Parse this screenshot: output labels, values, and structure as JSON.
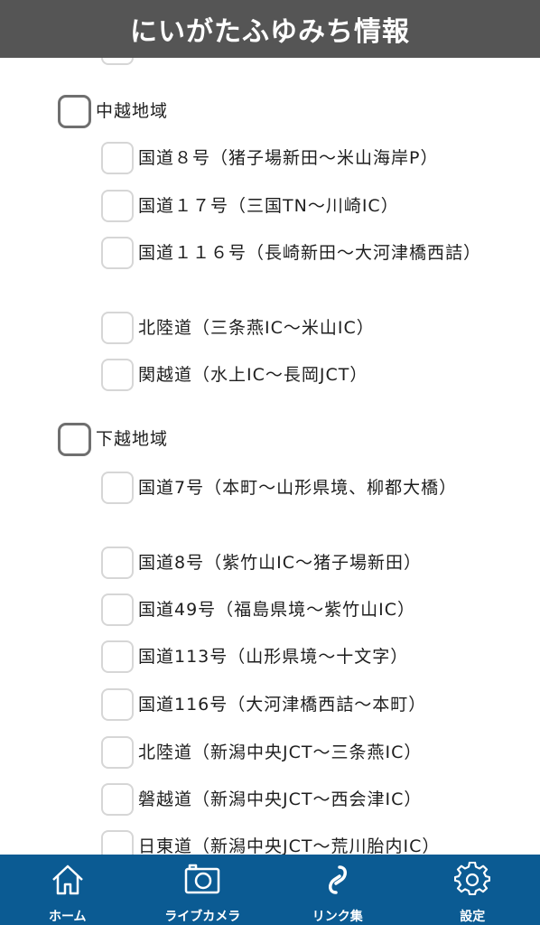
{
  "header": {
    "title": "にいがたふゆみち情報"
  },
  "regions": [
    {
      "label": "中越地域",
      "roads": [
        "国道８号（猪子場新田〜米山海岸P）",
        "国道１７号（三国TN〜川崎IC）",
        "国道１１６号（長崎新田〜大河津橋西詰）",
        "北陸道（三条燕IC〜米山IC）",
        "関越道（水上IC〜長岡JCT）"
      ]
    },
    {
      "label": "下越地域",
      "roads": [
        "国道7号（本町〜山形県境、柳都大橋）",
        "国道8号（紫竹山IC〜猪子場新田）",
        "国道49号（福島県境〜紫竹山IC）",
        "国道113号（山形県境〜十文字）",
        "国道116号（大河津橋西詰〜本町）",
        "北陸道（新潟中央JCT〜三条燕IC）",
        "磐越道（新潟中央JCT〜西会津IC）",
        "日東道（新潟中央JCT〜荒川胎内IC）"
      ]
    }
  ],
  "tabs": [
    {
      "label": "ホーム",
      "icon": "home-icon"
    },
    {
      "label": "ライブカメラ",
      "icon": "camera-icon"
    },
    {
      "label": "リンク集",
      "icon": "link-icon"
    },
    {
      "label": "設定",
      "icon": "gear-icon"
    }
  ]
}
